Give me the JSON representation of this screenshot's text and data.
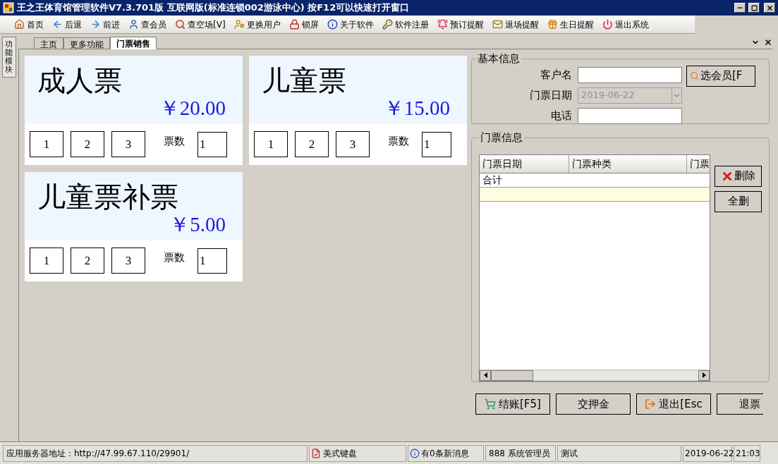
{
  "window": {
    "title": "王之王体育馆管理软件V7.3.701版 互联网版(标准连锁002游泳中心) 按F12可以快速打开窗口"
  },
  "toolbar": [
    {
      "label": "首页"
    },
    {
      "label": "后退"
    },
    {
      "label": "前进"
    },
    {
      "label": "查会员"
    },
    {
      "label": "查空场[V]"
    },
    {
      "label": "更换用户"
    },
    {
      "label": "锁屏"
    },
    {
      "label": "关于软件"
    },
    {
      "label": "软件注册"
    },
    {
      "label": "预订提醒"
    },
    {
      "label": "退场提醒"
    },
    {
      "label": "生日提醒"
    },
    {
      "label": "退出系统"
    }
  ],
  "side_panel": {
    "label": "功能模块"
  },
  "tabs": [
    {
      "label": "主页",
      "selected": false
    },
    {
      "label": "更多功能",
      "selected": false
    },
    {
      "label": "门票销售",
      "selected": true
    }
  ],
  "tickets": [
    {
      "name": "成人票",
      "price": "￥20.00",
      "quick_counts": [
        "1",
        "2",
        "3"
      ],
      "count_label": "票数",
      "count": "1"
    },
    {
      "name": "儿童票",
      "price": "￥15.00",
      "quick_counts": [
        "1",
        "2",
        "3"
      ],
      "count_label": "票数",
      "count": "1"
    },
    {
      "name": "儿童票补票",
      "price": "￥5.00",
      "quick_counts": [
        "1",
        "2",
        "3"
      ],
      "count_label": "票数",
      "count": "1"
    }
  ],
  "basic_info": {
    "title": "基本信息",
    "fields": [
      {
        "label": "客户名",
        "kind": "text",
        "disabled": false
      },
      {
        "label": "门票日期",
        "kind": "date",
        "value": "2019-06-22",
        "disabled": true
      },
      {
        "label": "电话",
        "kind": "text",
        "disabled": false
      }
    ],
    "member_button": "选会员[F"
  },
  "ticket_info": {
    "title": "门票信息",
    "columns": [
      "门票日期",
      "门票种类",
      "门票"
    ],
    "rows": [
      {
        "cells": [
          "合计"
        ],
        "selected": false
      },
      {
        "cells": [],
        "selected": true
      }
    ],
    "delete_button": "删除",
    "clear_button": "全删"
  },
  "actions": [
    "结账[F5]",
    "交押金",
    "退出[Esc",
    "退票"
  ],
  "status_bar": {
    "server": "应用服务器地址：http://47.99.67.110/29901/",
    "keyboard": "美式键盘",
    "messages": "有0条新消息",
    "user": "888 系统管理员",
    "note": "测试",
    "date": "2019-06-22",
    "time": "21:03"
  }
}
